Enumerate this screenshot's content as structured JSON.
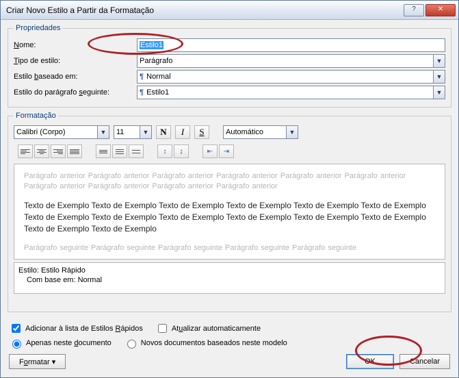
{
  "window": {
    "title": "Criar Novo Estilo a Partir da Formatação"
  },
  "properties": {
    "legend": "Propriedades",
    "name_label": "Nome:",
    "name_value": "Estilo1",
    "type_label": "Tipo de estilo:",
    "type_value": "Parágrafo",
    "based_label": "Estilo baseado em:",
    "based_value": "Normal",
    "following_label": "Estilo do parágrafo seguinte:",
    "following_value": "Estilo1"
  },
  "formatting": {
    "legend": "Formatação",
    "font": "Calibri (Corpo)",
    "size": "11",
    "bold": "N",
    "italic": "I",
    "underline": "S",
    "color": "Automático"
  },
  "preview": {
    "before": "Parágrafo anterior Parágrafo anterior Parágrafo anterior Parágrafo anterior Parágrafo anterior Parágrafo anterior Parágrafo anterior Parágrafo anterior Parágrafo anterior Parágrafo anterior",
    "sample": "Texto de Exemplo Texto de Exemplo Texto de Exemplo Texto de Exemplo Texto de Exemplo Texto de Exemplo Texto de Exemplo Texto de Exemplo Texto de Exemplo Texto de Exemplo Texto de Exemplo Texto de Exemplo Texto de Exemplo Texto de Exemplo",
    "after": "Parágrafo seguinte Parágrafo seguinte Parágrafo seguinte Parágrafo seguinte Parágrafo seguinte"
  },
  "info": {
    "line1": "Estilo: Estilo Rápido",
    "line2": "Com base em: Normal"
  },
  "options": {
    "add_quick": "Adicionar à lista de Estilos Rápidos",
    "auto_update": "Atualizar automaticamente",
    "only_doc": "Apenas neste documento",
    "new_docs": "Novos documentos baseados neste modelo"
  },
  "buttons": {
    "format": "Formatar ",
    "ok": "OK",
    "cancel": "Cancelar"
  },
  "accel": {
    "nome_pre": "N",
    "nome_post": "ome:",
    "tipo_pre": "T",
    "tipo_post": "ipo de estilo:",
    "base_pre": "Estilo ",
    "base_u": "b",
    "base_post": "aseado em:",
    "seg_pre": "Estilo do parágrafo ",
    "seg_u": "s",
    "seg_post": "eguinte:",
    "addq_pre": "Adicionar à lista de Estilos ",
    "addq_u": "R",
    "addq_post": "ápidos",
    "auto_pre": "At",
    "auto_u": "u",
    "auto_post": "alizar automaticamente",
    "only_pre": "Apenas neste ",
    "only_u": "d",
    "only_post": "ocumento",
    "fmt_pre": "F",
    "fmt_u": "o",
    "fmt_post": "rmatar "
  }
}
